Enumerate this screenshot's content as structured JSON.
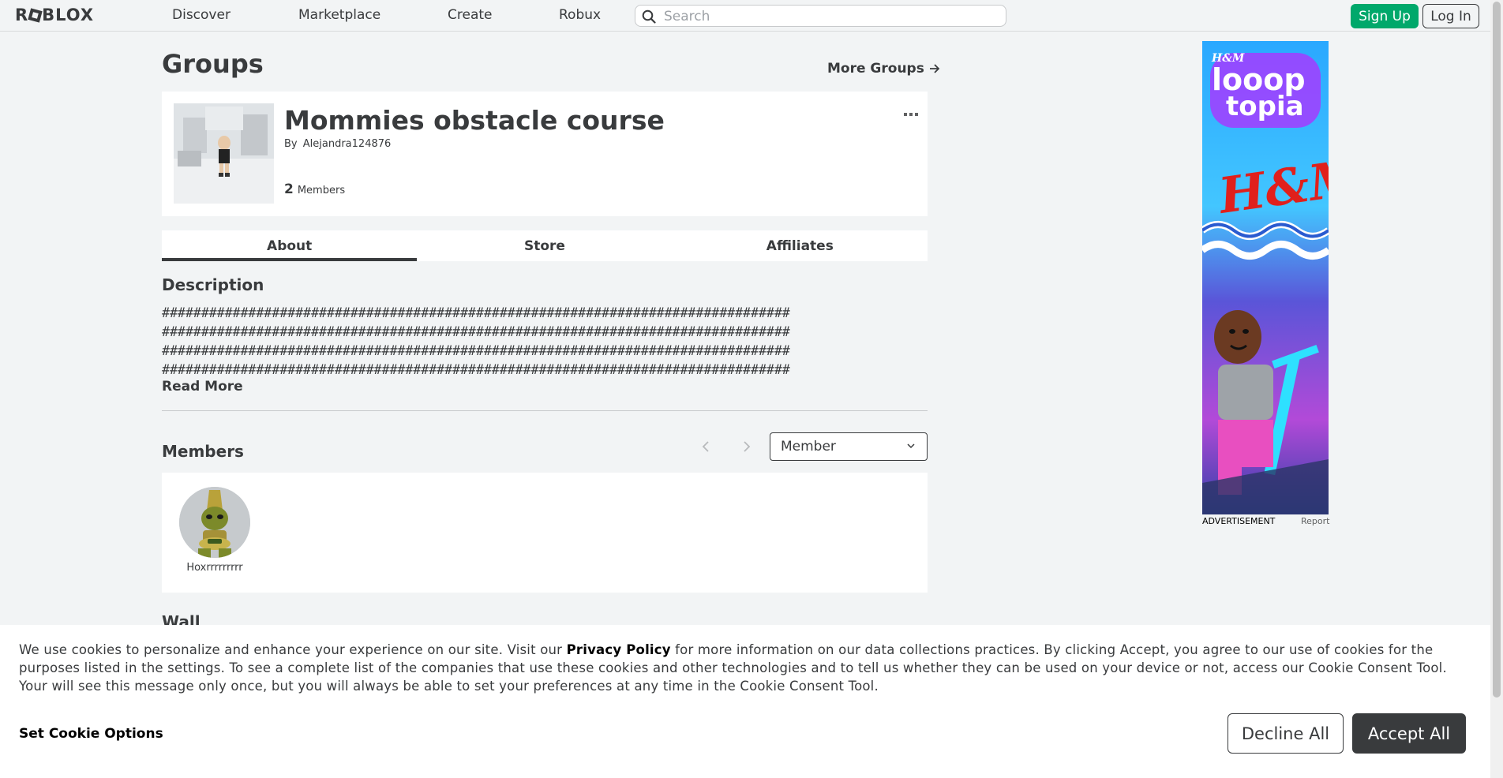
{
  "nav": {
    "logo": "ROBLOX",
    "links": [
      "Discover",
      "Marketplace",
      "Create",
      "Robux"
    ],
    "search_placeholder": "Search",
    "signup_label": "Sign Up",
    "login_label": "Log In"
  },
  "page": {
    "title": "Groups",
    "more_groups": "More Groups"
  },
  "group": {
    "name": "Mommies obstacle course",
    "by_label": "By",
    "owner": "Alejandra124876",
    "member_count": "2",
    "members_label": "Members"
  },
  "tabs": [
    "About",
    "Store",
    "Affiliates"
  ],
  "about": {
    "description_heading": "Description",
    "description_text": "################################################################################\n################################################################################\n################################################################################\n################################################################################",
    "read_more": "Read More"
  },
  "members": {
    "heading": "Members",
    "role_selected": "Member",
    "list": [
      {
        "name": "Hoxrrrrrrrrr"
      }
    ]
  },
  "wall": {
    "heading": "Wall"
  },
  "ad": {
    "label": "ADVERTISEMENT",
    "report": "Report",
    "brand_top": "H&M",
    "headline_1": "looop",
    "headline_2": "topia",
    "brand_mid": "H&M"
  },
  "cookie": {
    "text_before_link": "We use cookies to personalize and enhance your experience on our site. Visit our ",
    "link": "Privacy Policy",
    "text_after_link": " for more information on our data collections practices. By clicking Accept, you agree to our use of cookies for the purposes listed in the settings. To see a complete list of the companies that use these cookies and other technologies and to tell us whether they can be used on your device or not, access our Cookie Consent Tool. Your will see this message only once, but you will always be able to set your preferences at any time in the Cookie Consent Tool.",
    "options_label": "Set Cookie Options",
    "decline_label": "Decline All",
    "accept_label": "Accept All"
  },
  "colors": {
    "signup_green": "#00a86b",
    "text_dark": "#393b3d",
    "page_bg": "#f2f4f5"
  }
}
